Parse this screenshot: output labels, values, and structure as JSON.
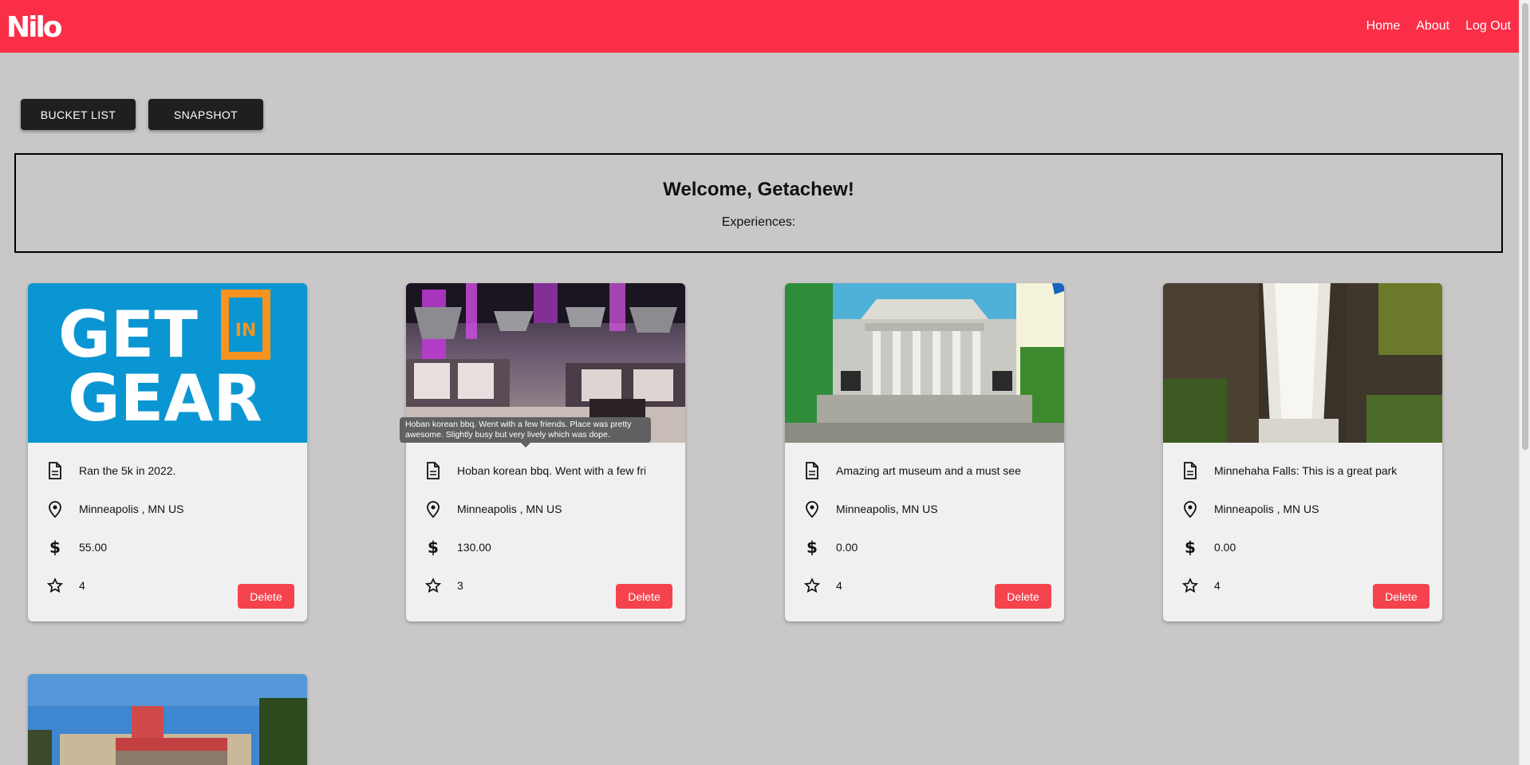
{
  "nav": {
    "logo_text": "Nilo",
    "links": [
      "Home",
      "About",
      "Log Out"
    ]
  },
  "actions": {
    "bucket_list": "BUCKET LIST",
    "snapshot": "SNAPSHOT"
  },
  "welcome": {
    "title": "Welcome, Getachew!",
    "subtitle": "Experiences:"
  },
  "cards": [
    {
      "description": "Ran the 5k in 2022.",
      "location": "Minneapolis , MN US",
      "cost": "55.00",
      "rating": "4",
      "delete_label": "Delete",
      "image": "get-in-gear-logo",
      "image_text": [
        "GET",
        "IN",
        "GEAR"
      ]
    },
    {
      "description": "Hoban korean bbq. Went with a few friends. Place was pretty awesome. Slightly busy but very lively which was dope.",
      "location": "Minneapolis , MN US",
      "cost": "130.00",
      "rating": "3",
      "delete_label": "Delete",
      "image": "restaurant-interior"
    },
    {
      "description": "Amazing art museum and a must see",
      "location": "Minneapolis, MN US",
      "cost": "0.00",
      "rating": "4",
      "delete_label": "Delete",
      "image": "art-museum"
    },
    {
      "description": "Minnehaha Falls: This is a great park",
      "location": "Minneapolis , MN US",
      "cost": "0.00",
      "rating": "4",
      "delete_label": "Delete",
      "image": "waterfall"
    },
    {
      "image": "theater-building"
    }
  ],
  "tooltip": "Hoban korean bbq. Went with a few friends. Place was pretty awesome. Slightly busy but very lively which was dope.",
  "icons": {
    "description": "document-icon",
    "location": "location-pin-icon",
    "cost": "dollar-icon",
    "rating": "star-icon"
  },
  "colors": {
    "navbar": "#fb2e48",
    "background": "#c9c7c8",
    "button_dark": "#1f1f1f",
    "delete": "#f5434e"
  }
}
